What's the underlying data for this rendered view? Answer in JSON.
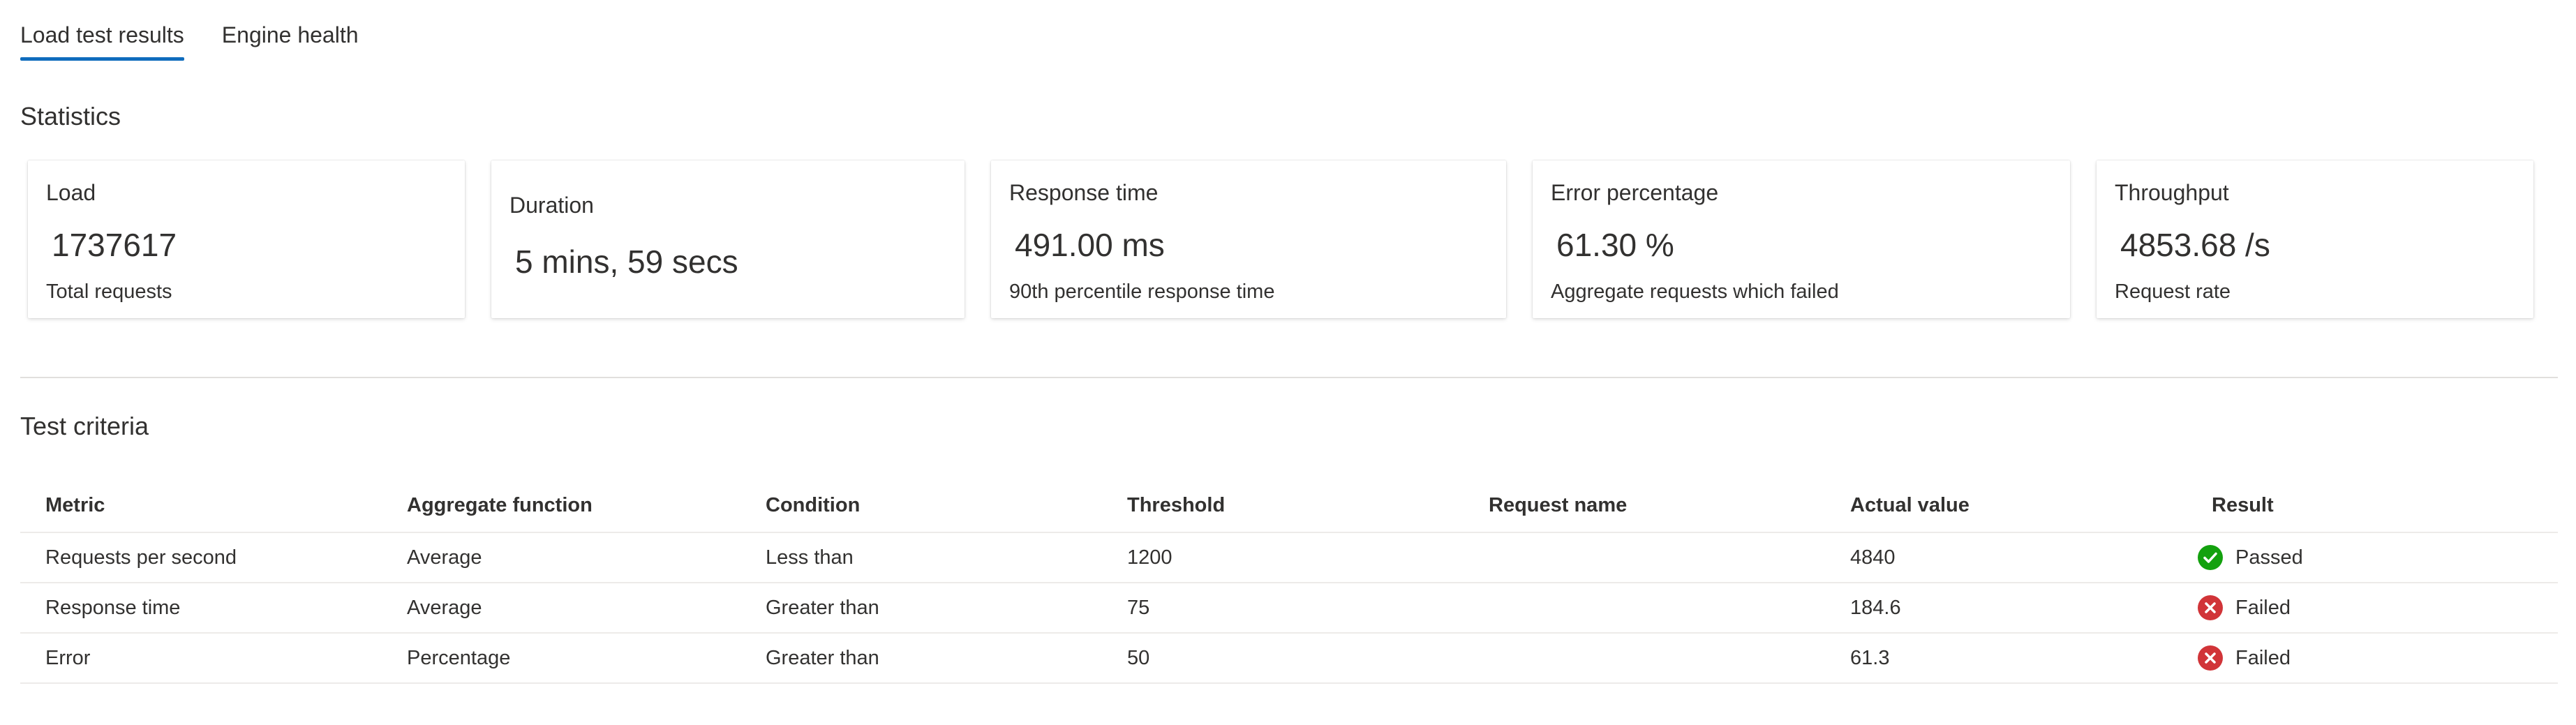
{
  "tabs": [
    {
      "label": "Load test results",
      "active": true
    },
    {
      "label": "Engine health",
      "active": false
    }
  ],
  "statistics": {
    "title": "Statistics",
    "cards": {
      "load": {
        "title": "Load",
        "value": "1737617",
        "subtitle": "Total requests"
      },
      "duration": {
        "title": "Duration",
        "value": "5 mins, 59 secs"
      },
      "response_time": {
        "title": "Response time",
        "value": "491.00 ms",
        "subtitle": "90th percentile response time"
      },
      "error_percentage": {
        "title": "Error percentage",
        "value": "61.30 %",
        "subtitle": "Aggregate requests which failed"
      },
      "throughput": {
        "title": "Throughput",
        "value": "4853.68 /s",
        "subtitle": "Request rate"
      }
    }
  },
  "test_criteria": {
    "title": "Test criteria",
    "columns": {
      "metric": "Metric",
      "aggregate_function": "Aggregate function",
      "condition": "Condition",
      "threshold": "Threshold",
      "request_name": "Request name",
      "actual_value": "Actual value",
      "result": "Result"
    },
    "rows": [
      {
        "metric": "Requests per second",
        "aggregate_function": "Average",
        "condition": "Less than",
        "threshold": "1200",
        "request_name": "",
        "actual_value": "4840",
        "result": "Passed",
        "result_icon": "check-circle-icon"
      },
      {
        "metric": "Response time",
        "aggregate_function": "Average",
        "condition": "Greater than",
        "threshold": "75",
        "request_name": "",
        "actual_value": "184.6",
        "result": "Failed",
        "result_icon": "error-circle-icon"
      },
      {
        "metric": "Error",
        "aggregate_function": "Percentage",
        "condition": "Greater than",
        "threshold": "50",
        "request_name": "",
        "actual_value": "61.3",
        "result": "Failed",
        "result_icon": "error-circle-icon"
      }
    ]
  },
  "colors": {
    "accent": "#0f6cbd",
    "passed": "#13a10e",
    "failed": "#d13438",
    "text": "#323130",
    "divider": "#e1dfdd"
  }
}
